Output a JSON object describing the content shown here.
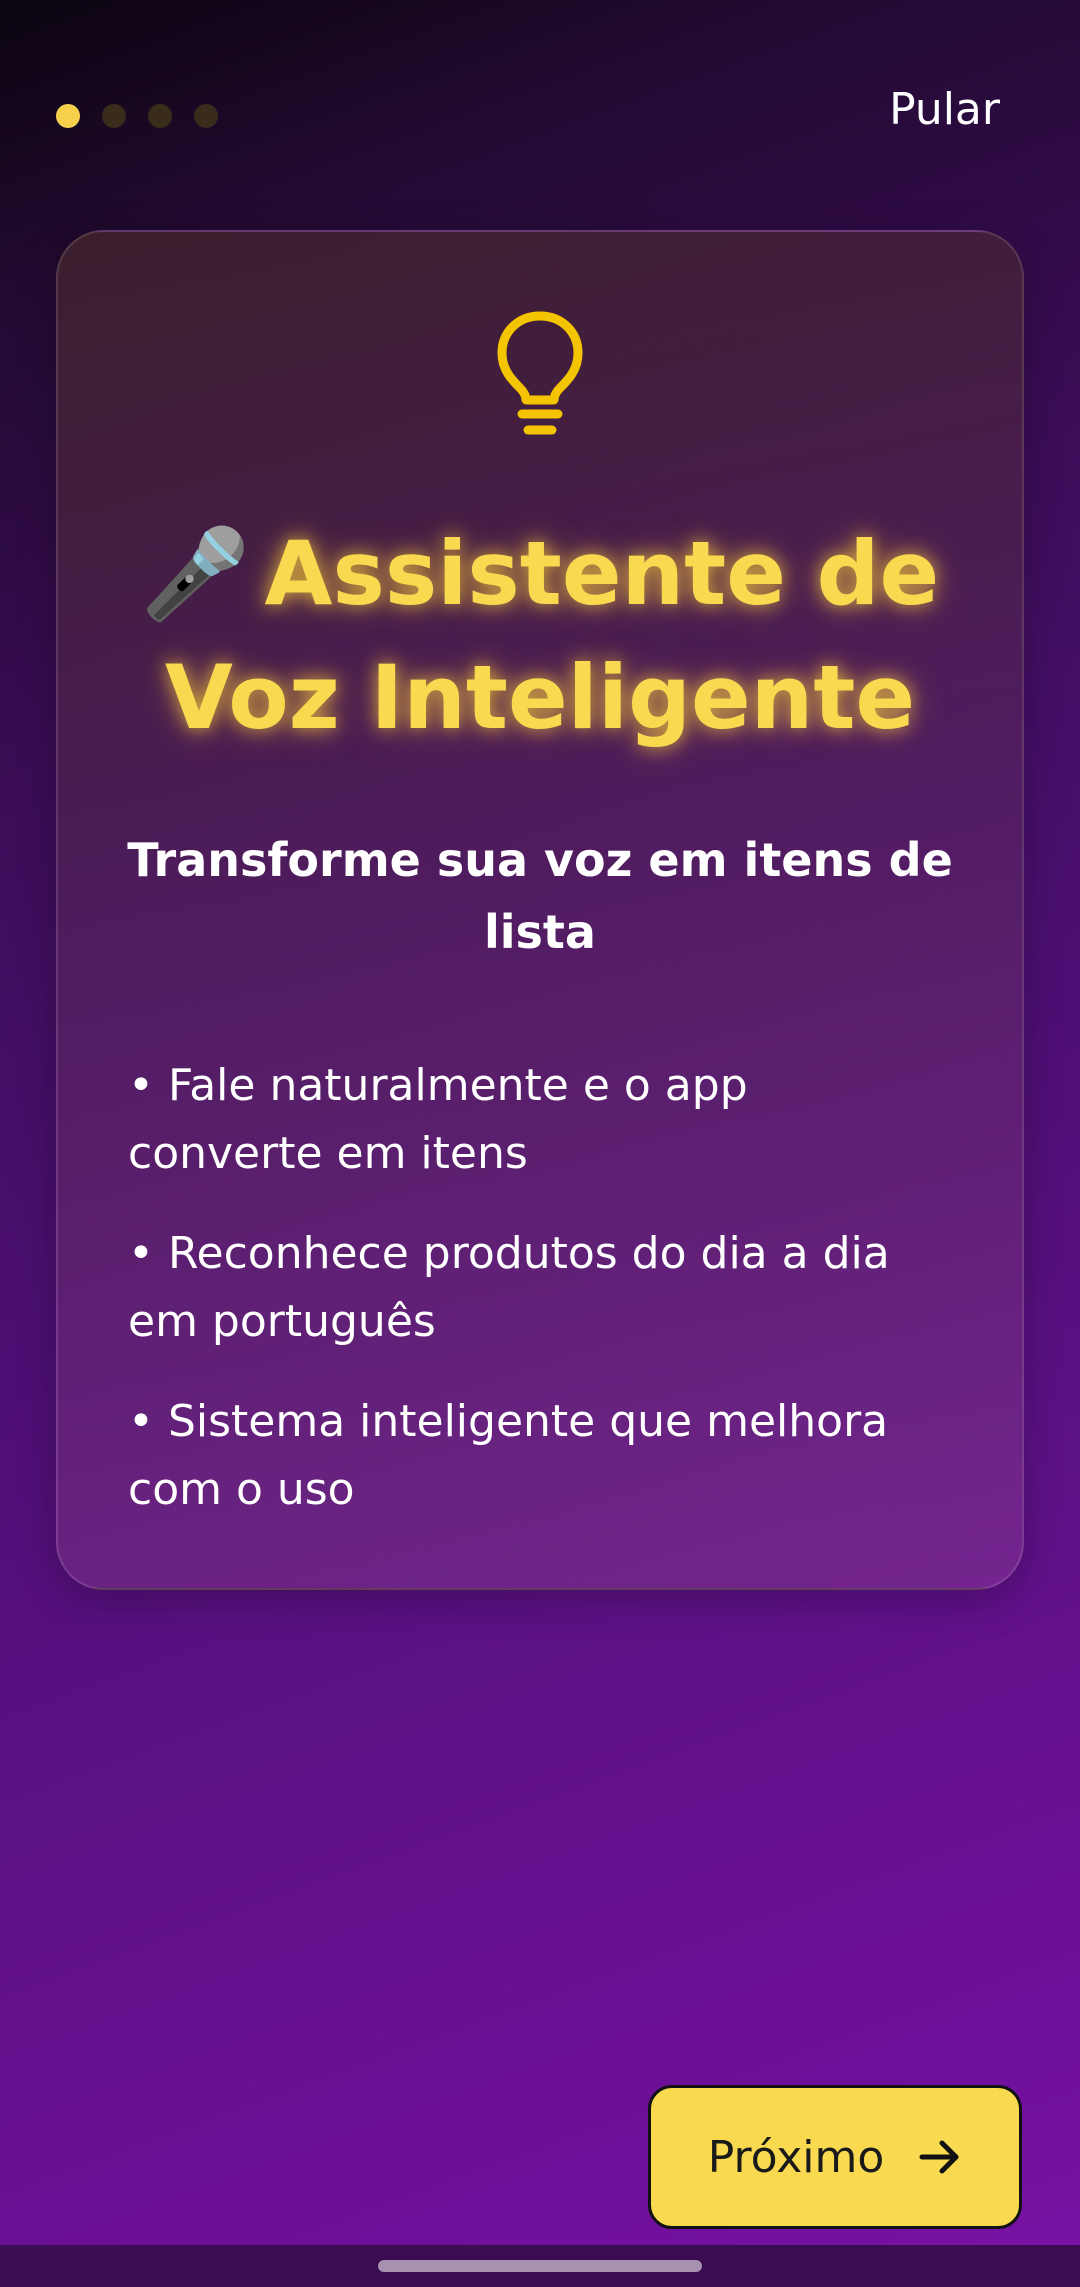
{
  "pager": {
    "total": 4,
    "active_index": 0
  },
  "header": {
    "skip_label": "Pular"
  },
  "card": {
    "icon": "lightbulb-icon",
    "title_emoji": "🎤",
    "title": "Assistente de Voz Inteligente",
    "subtitle": "Transforme sua voz em itens de lista",
    "bullets": [
      "• Fale naturalmente e o app converte em itens",
      "• Reconhece produtos do dia a dia em português",
      "• Sistema inteligente que melhora com o uso"
    ]
  },
  "footer": {
    "next_label": "Próximo",
    "next_icon": "arrow-right-icon"
  },
  "colors": {
    "accent": "#f8d94f",
    "dot_inactive": "#3a2c1a",
    "text": "#ffffff"
  }
}
